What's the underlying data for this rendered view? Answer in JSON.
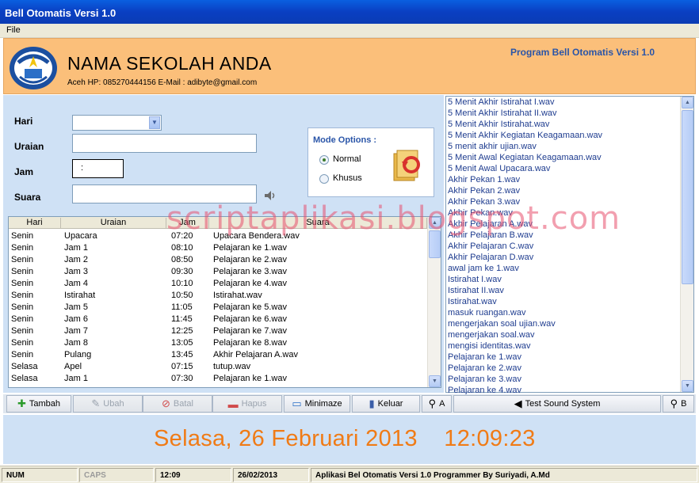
{
  "window": {
    "title": "Bell Otomatis Versi 1.0"
  },
  "menu": {
    "file": "File"
  },
  "header": {
    "school_name": "NAMA SEKOLAH ANDA",
    "contact": "Aceh HP: 085270444156 E-Mail : adibyte@gmail.com",
    "program_title": "Program Bell Otomatis Versi 1.0"
  },
  "form": {
    "hari_label": "Hari",
    "uraian_label": "Uraian",
    "jam_label": "Jam",
    "jam_value": ":",
    "suara_label": "Suara"
  },
  "mode": {
    "title": "Mode Options :",
    "normal": "Normal",
    "khusus": "Khusus",
    "selected": "Normal"
  },
  "table": {
    "headers": [
      "Hari",
      "Uraian",
      "Jam",
      "Suara"
    ],
    "rows": [
      [
        "Senin",
        "Upacara",
        "07:20",
        "Upacara Bendera.wav"
      ],
      [
        "Senin",
        "Jam 1",
        "08:10",
        "Pelajaran ke 1.wav"
      ],
      [
        "Senin",
        "Jam 2",
        "08:50",
        "Pelajaran ke 2.wav"
      ],
      [
        "Senin",
        "Jam 3",
        "09:30",
        "Pelajaran ke 3.wav"
      ],
      [
        "Senin",
        "Jam 4",
        "10:10",
        "Pelajaran ke 4.wav"
      ],
      [
        "Senin",
        "Istirahat",
        "10:50",
        "Istirahat.wav"
      ],
      [
        "Senin",
        "Jam 5",
        "11:05",
        "Pelajaran ke 5.wav"
      ],
      [
        "Senin",
        "Jam 6",
        "11:45",
        "Pelajaran ke 6.wav"
      ],
      [
        "Senin",
        "Jam 7",
        "12:25",
        "Pelajaran ke 7.wav"
      ],
      [
        "Senin",
        "Jam 8",
        "13:05",
        "Pelajaran ke 8.wav"
      ],
      [
        "Senin",
        "Pulang",
        "13:45",
        "Akhir Pelajaran A.wav"
      ],
      [
        "Selasa",
        "Apel",
        "07:15",
        "tutup.wav"
      ],
      [
        "Selasa",
        "Jam 1",
        "07:30",
        "Pelajaran ke 1.wav"
      ]
    ]
  },
  "files": [
    "5 Menit Akhir Istirahat I.wav",
    "5 Menit Akhir Istirahat II.wav",
    "5 Menit Akhir Istirahat.wav",
    "5 Menit Akhir Kegiatan Keagamaan.wav",
    "5 menit akhir ujian.wav",
    "5 Menit Awal Kegiatan Keagamaan.wav",
    "5 Menit Awal Upacara.wav",
    "Akhir Pekan 1.wav",
    "Akhir Pekan 2.wav",
    "Akhir Pekan 3.wav",
    "Akhir Pekan.wav",
    "Akhir Pelajaran A.wav",
    "Akhir Pelajaran B.wav",
    "Akhir Pelajaran C.wav",
    "Akhir Pelajaran D.wav",
    "awal jam ke 1.wav",
    "Istirahat I.wav",
    "Istirahat II.wav",
    "Istirahat.wav",
    "masuk ruangan.wav",
    "mengerjakan soal ujian.wav",
    "mengerjakan soal.wav",
    "mengisi identitas.wav",
    "Pelajaran ke 1.wav",
    "Pelajaran ke 2.wav",
    "Pelajaran ke 3.wav",
    "Pelajaran ke 4.wav"
  ],
  "toolbar": {
    "tambah": "Tambah",
    "ubah": "Ubah",
    "batal": "Batal",
    "hapus": "Hapus",
    "minimize": "Minimaze",
    "keluar": "Keluar",
    "a": "A",
    "test_sound": "Test Sound System",
    "b": "B"
  },
  "datetime": "Selasa, 26 Februari 2013    12:09:23",
  "status": {
    "num": "NUM",
    "caps": "CAPS",
    "time": "12:09",
    "date": "26/02/2013",
    "credit": "Aplikasi Bel Otomatis Versi 1.0 Programmer By Suriyadi, A.Md"
  },
  "watermark": "scriptaplikasi.blogspot.com",
  "colors": {
    "header_bg": "#fbbf7a",
    "panel_bg": "#cfe1f5",
    "datetime": "#f07b16",
    "file_text": "#1e3c8f"
  }
}
